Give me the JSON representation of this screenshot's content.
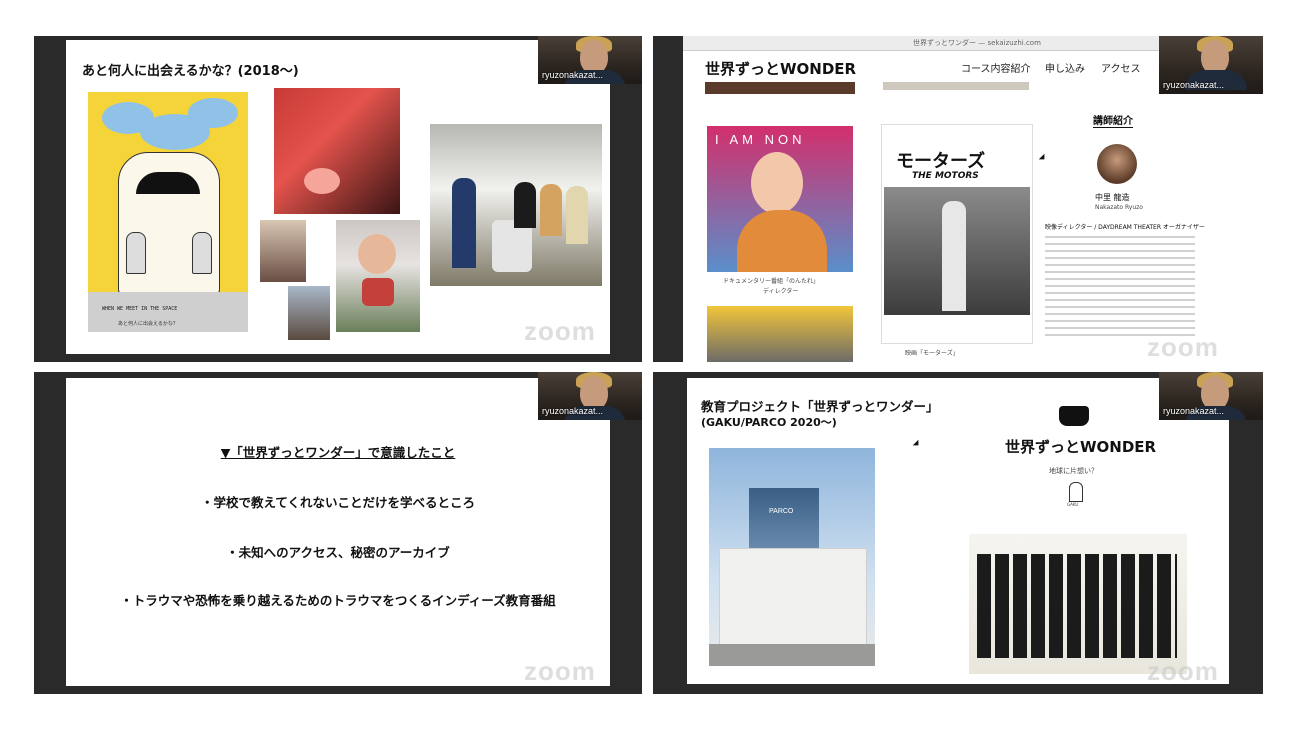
{
  "participant": {
    "name": "ryuzonakazat..."
  },
  "zoom_watermark": "zoom",
  "panel1": {
    "title": "あと何人に出会えるかな？(2018〜)",
    "poster_text": "WHEN WE MEET IN THE SPACE",
    "poster_caption": "あと何人に出会えるかな？"
  },
  "panel2": {
    "url": "世界ずっとワンダー — sekaizuzhi.com",
    "logo": "世界ずっとWONDER",
    "nav": [
      "コース内容紹介",
      "申し込み",
      "アクセス"
    ],
    "film1_caption": "ドキュメンタリー番組「のんたれ」",
    "film1_sub": "ディレクター",
    "film1_poster": "I AM NON",
    "film2_title": "モーターズ",
    "film2_sub": "THE MOTORS",
    "film2_caption": "映画「モーターズ」",
    "section_title": "講師紹介",
    "lecturer_name": "中里 龍造",
    "lecturer_roman": "Nakazato Ryuzo",
    "lecturer_role": "映像ディレクター / DAYDREAM THEATER オーガナイザー"
  },
  "panel3": {
    "heading": "▼「世界ずっとワンダー」で意識したこと",
    "bullets": [
      "・学校で教えてくれないことだけを学べるところ",
      "・未知へのアクセス、秘密のアーカイブ",
      "・トラウマや恐怖を乗り越えるためのトラウマをつくるインディーズ教育番組"
    ]
  },
  "panel4": {
    "title_line1": "教育プロジェクト「世界ずっとワンダー」",
    "title_line2": "(GAKU/PARCO 2020〜)",
    "logo": "世界ずっとWONDER",
    "tagline": "地球に片想い？",
    "gaku": "GAKU",
    "building_sign": "PARCO"
  },
  "colors": {
    "frame": "#2a2a2a",
    "accent_yellow": "#f5d43a",
    "sky": "#8fc2e6"
  }
}
